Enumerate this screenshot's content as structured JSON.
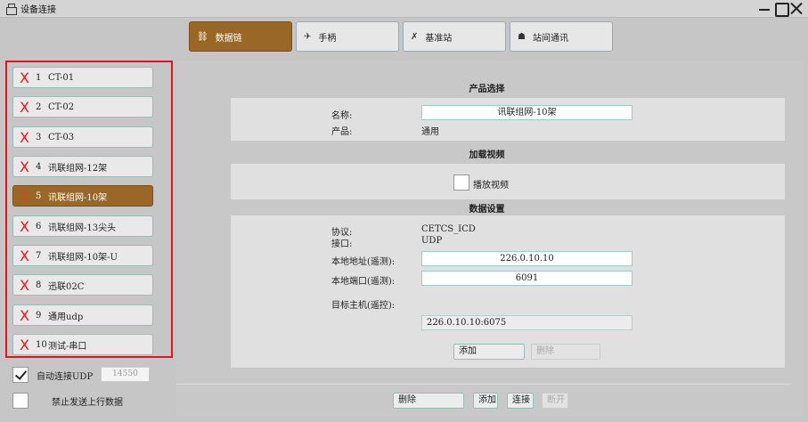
{
  "window": {
    "title": "设备连接"
  },
  "tabs": [
    {
      "label": "数据链",
      "icon": "link-icon",
      "glyph": "🔗",
      "active": true
    },
    {
      "label": "手柄",
      "icon": "joystick-icon",
      "glyph": "🎮",
      "active": false
    },
    {
      "label": "基准站",
      "icon": "satellite-icon",
      "glyph": "🛰",
      "active": false
    },
    {
      "label": "站间通讯",
      "icon": "users-icon",
      "glyph": "👥",
      "active": false
    }
  ],
  "devices": [
    {
      "x": "X",
      "num": "1",
      "name": "CT-01"
    },
    {
      "x": "X",
      "num": "2",
      "name": "CT-02"
    },
    {
      "x": "X",
      "num": "3",
      "name": "CT-03"
    },
    {
      "x": "X",
      "num": "4",
      "name": "讯联组网-12架"
    },
    {
      "x": "X",
      "num": "5",
      "name": "讯联组网-10架"
    },
    {
      "x": "X",
      "num": "6",
      "name": "讯联组网-13尖头"
    },
    {
      "x": "X",
      "num": "7",
      "name": "讯联组网-10架-U"
    },
    {
      "x": "X",
      "num": "8",
      "name": "迅联02C"
    },
    {
      "x": "X",
      "num": "9",
      "name": "通用udp"
    },
    {
      "x": "X",
      "num": "10",
      "name": "测试-串口"
    }
  ],
  "active_device_index": 4,
  "options": {
    "auto_udp_label": "自动连接UDP",
    "auto_udp_checked": true,
    "udp_port": "14550",
    "no_uplink_label": "禁止发送上行数据",
    "no_uplink_checked": false
  },
  "product": {
    "section_title": "产品选择",
    "name_label": "名称:",
    "name_value": "讯联组网-10架",
    "product_label": "产品:",
    "product_value": "通用"
  },
  "video": {
    "section_title": "加载视频",
    "play_label": "播放视频",
    "play_checked": false
  },
  "data_settings": {
    "section_title": "数据设置",
    "protocol_label": "协议:",
    "protocol_value": "CETCS_ICD",
    "interface_label": "接口:",
    "interface_value": "UDP",
    "local_addr_label": "本地地址(遥测):",
    "local_addr_value": "226.0.10.10",
    "local_port_label": "本地端口(遥测):",
    "local_port_value": "6091",
    "target_label": "目标主机(遥控):",
    "target_value": "226.0.10.10:6075",
    "add_label": "添加",
    "delete_label": "删除"
  },
  "bottom_buttons": {
    "delete": "删除",
    "add": "添加",
    "connect": "连接",
    "disconnect": "断开"
  },
  "colors": {
    "accent": "#9a6826",
    "danger": "#e01b1b",
    "highlight_border": "#e0141a"
  }
}
